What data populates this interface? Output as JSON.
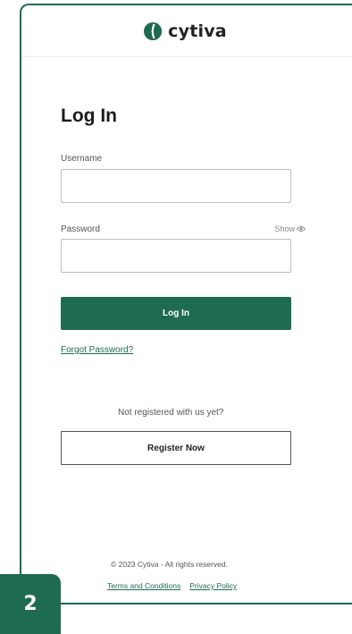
{
  "brand": {
    "name": "cytiva",
    "icon": "cytiva-logo-icon",
    "accent": "#1f6b52"
  },
  "login": {
    "title": "Log In",
    "username_label": "Username",
    "username_value": "",
    "password_label": "Password",
    "password_value": "",
    "show_label": "Show",
    "show_icon": "eye-icon",
    "submit_label": "Log In",
    "forgot_label": "Forgot Password?"
  },
  "register": {
    "prompt": "Not registered with us yet?",
    "button_label": "Register Now"
  },
  "footer": {
    "copyright": "© 2023 Cytiva - All rights reserved.",
    "terms_label": "Terms and Conditions",
    "privacy_label": "Privacy Policy"
  },
  "step": {
    "number": "2"
  }
}
